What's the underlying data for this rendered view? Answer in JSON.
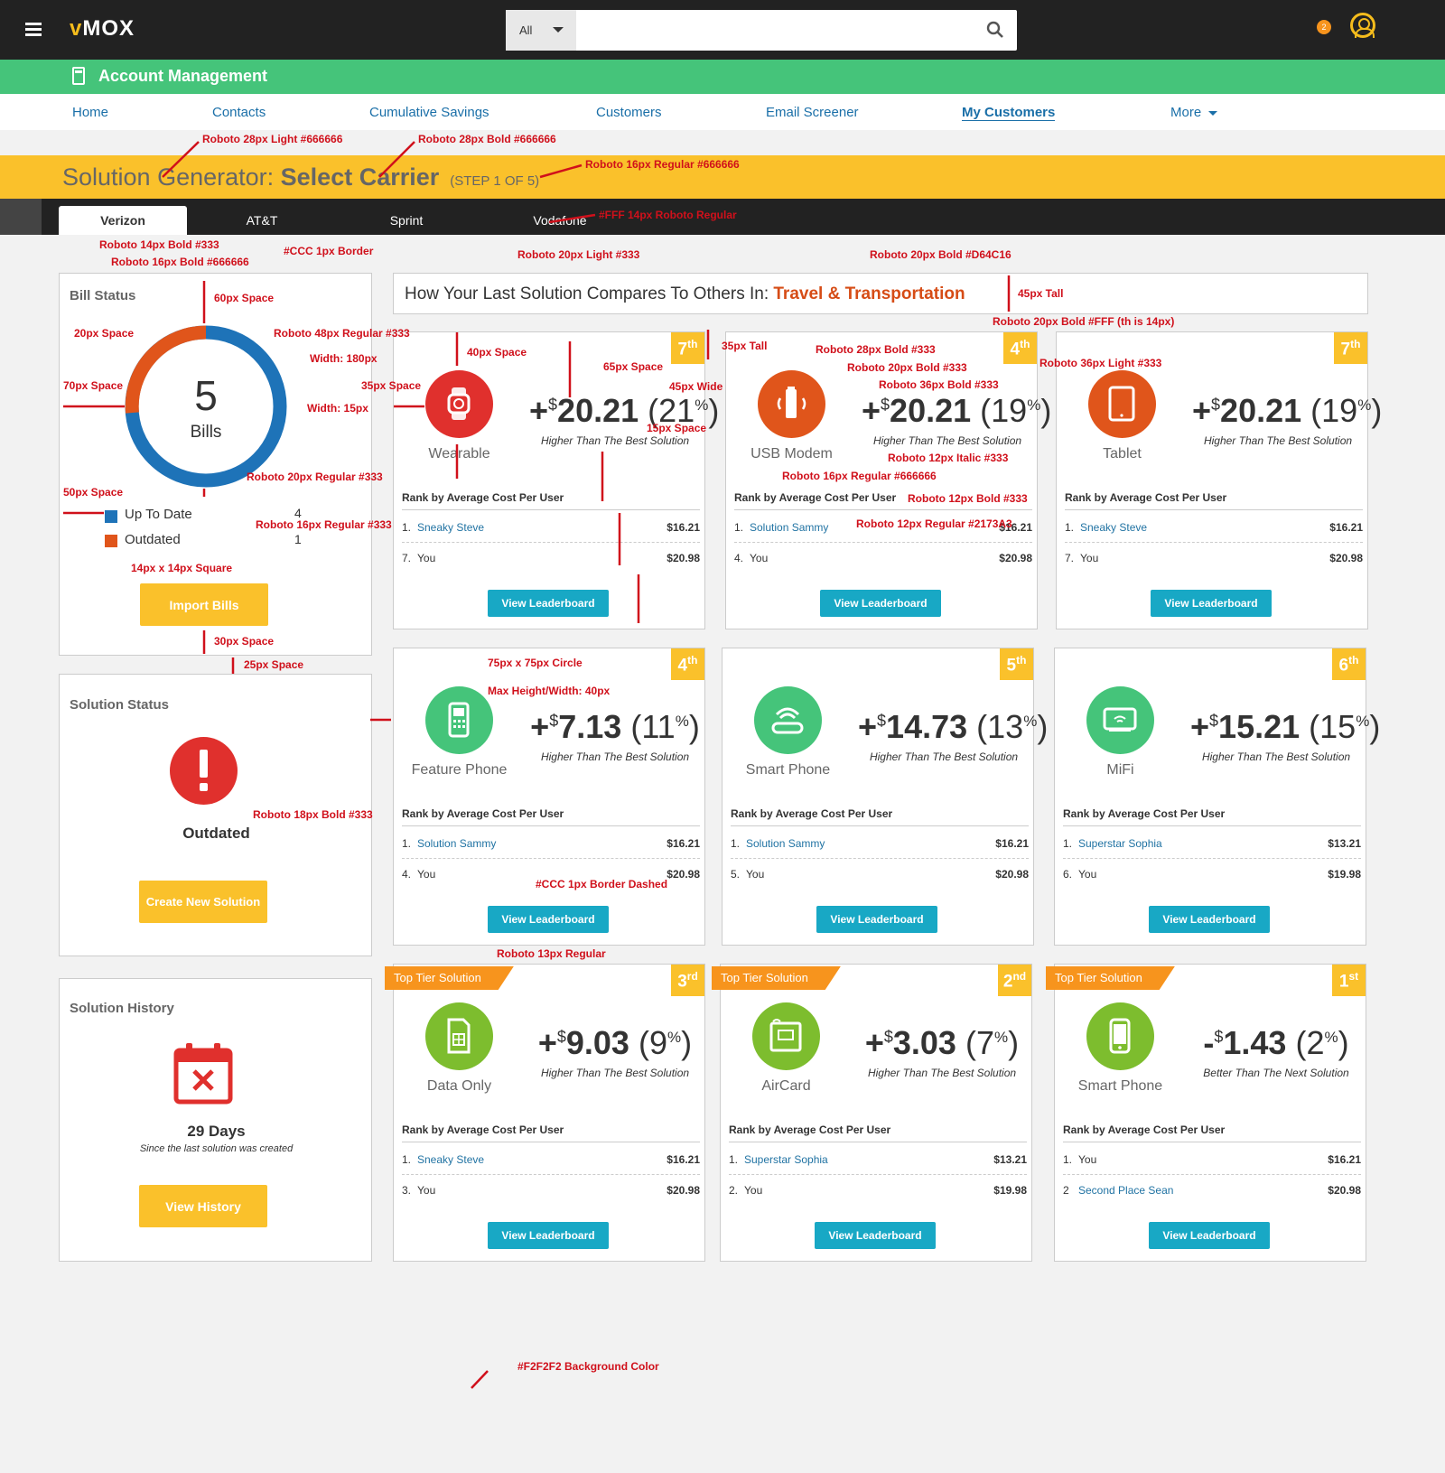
{
  "brand": {
    "logo_v": "v",
    "logo_rest": "MOX"
  },
  "search": {
    "scope": "All",
    "placeholder": ""
  },
  "notifications": {
    "count": "2"
  },
  "module": {
    "title": "Account Management"
  },
  "nav": {
    "items": [
      "Home",
      "Contacts",
      "Cumulative Savings",
      "Customers",
      "Email Screener",
      "My Customers",
      "More"
    ],
    "active": "My Customers"
  },
  "header": {
    "title_light": "Solution Generator: ",
    "title_bold": "Select Carrier",
    "step": "(STEP 1 OF 5)"
  },
  "carriers": {
    "tabs": [
      "Verizon",
      "AT&T",
      "Sprint",
      "Vodafone"
    ],
    "active": "Verizon"
  },
  "bill_status": {
    "title": "Bill Status",
    "total": "5",
    "total_label": "Bills",
    "legend": [
      {
        "label": "Up To Date",
        "count": "4",
        "color": "#1E73B8"
      },
      {
        "label": "Outdated",
        "count": "1",
        "color": "#E0551B"
      }
    ],
    "button": "Import Bills"
  },
  "solution_status": {
    "title": "Solution Status",
    "status": "Outdated",
    "button": "Create New Solution"
  },
  "solution_history": {
    "title": "Solution History",
    "days": "29 Days",
    "caption": "Since the last solution was created",
    "button": "View History"
  },
  "compare": {
    "prefix": "How Your Last Solution Compares To Others In: ",
    "industry": "Travel & Transportation"
  },
  "cards": [
    {
      "rank": "7",
      "rank_suffix": "th",
      "device": "Wearable",
      "icon": "watch-icon",
      "color": "#E0302D",
      "sign": "+",
      "amount": "20.21",
      "pct": "21",
      "sub": "Higher Than The Best Solution",
      "rank_label": "Rank by Average Cost Per User",
      "rows": [
        {
          "n": "1.",
          "name": "Sneaky Steve",
          "amt": "$16.21"
        },
        {
          "n": "7.",
          "name": "You",
          "amt": "$20.98"
        }
      ],
      "button": "View Leaderboard",
      "tier": ""
    },
    {
      "rank": "4",
      "rank_suffix": "th",
      "device": "USB Modem",
      "icon": "usb-modem-icon",
      "color": "#E0551B",
      "sign": "+",
      "amount": "20.21",
      "pct": "19",
      "sub": "Higher Than The Best Solution",
      "rank_label": "Rank by Average Cost Per User",
      "rows": [
        {
          "n": "1.",
          "name": "Solution Sammy",
          "amt": "$16.21"
        },
        {
          "n": "4.",
          "name": "You",
          "amt": "$20.98"
        }
      ],
      "button": "View Leaderboard",
      "tier": ""
    },
    {
      "rank": "7",
      "rank_suffix": "th",
      "device": "Tablet",
      "icon": "tablet-icon",
      "color": "#E0551B",
      "sign": "+",
      "amount": "20.21",
      "pct": "19",
      "sub": "Higher Than The Best Solution",
      "rank_label": "Rank by Average Cost Per User",
      "rows": [
        {
          "n": "1.",
          "name": "Sneaky Steve",
          "amt": "$16.21"
        },
        {
          "n": "7.",
          "name": "You",
          "amt": "$20.98"
        }
      ],
      "button": "View Leaderboard",
      "tier": ""
    },
    {
      "rank": "4",
      "rank_suffix": "th",
      "device": "Feature Phone",
      "icon": "feature-phone-icon",
      "color": "#45C47A",
      "sign": "+",
      "amount": "7.13",
      "pct": "11",
      "sub": "Higher Than The Best Solution",
      "rank_label": "Rank by Average Cost Per User",
      "rows": [
        {
          "n": "1.",
          "name": "Solution Sammy",
          "amt": "$16.21"
        },
        {
          "n": "4.",
          "name": "You",
          "amt": "$20.98"
        }
      ],
      "button": "View Leaderboard",
      "tier": ""
    },
    {
      "rank": "5",
      "rank_suffix": "th",
      "device": "Smart Phone",
      "icon": "wifi-router-icon",
      "color": "#45C47A",
      "sign": "+",
      "amount": "14.73",
      "pct": "13",
      "sub": "Higher Than The Best Solution",
      "rank_label": "Rank by Average Cost Per User",
      "rows": [
        {
          "n": "1.",
          "name": "Solution Sammy",
          "amt": "$16.21"
        },
        {
          "n": "5.",
          "name": "You",
          "amt": "$20.98"
        }
      ],
      "button": "View Leaderboard",
      "tier": ""
    },
    {
      "rank": "6",
      "rank_suffix": "th",
      "device": "MiFi",
      "icon": "mifi-icon",
      "color": "#45C47A",
      "sign": "+",
      "amount": "15.21",
      "pct": "15",
      "sub": "Higher Than The Best Solution",
      "rank_label": "Rank by Average Cost Per User",
      "rows": [
        {
          "n": "1.",
          "name": "Superstar Sophia",
          "amt": "$13.21"
        },
        {
          "n": "6.",
          "name": "You",
          "amt": "$19.98"
        }
      ],
      "button": "View Leaderboard",
      "tier": ""
    },
    {
      "rank": "3",
      "rank_suffix": "rd",
      "device": "Data Only",
      "icon": "sim-card-icon",
      "color": "#7DBD2E",
      "sign": "+",
      "amount": "9.03",
      "pct": "9",
      "sub": "Higher Than The Best Solution",
      "rank_label": "Rank by Average Cost Per User",
      "rows": [
        {
          "n": "1.",
          "name": "Sneaky Steve",
          "amt": "$16.21"
        },
        {
          "n": "3.",
          "name": "You",
          "amt": "$20.98"
        }
      ],
      "button": "View Leaderboard",
      "tier": "Top Tier Solution"
    },
    {
      "rank": "2",
      "rank_suffix": "nd",
      "device": "AirCard",
      "icon": "aircard-icon",
      "color": "#7DBD2E",
      "sign": "+",
      "amount": "3.03",
      "pct": "7",
      "sub": "Higher Than The Best Solution",
      "rank_label": "Rank by Average Cost Per User",
      "rows": [
        {
          "n": "1.",
          "name": "Superstar Sophia",
          "amt": "$13.21"
        },
        {
          "n": "2.",
          "name": "You",
          "amt": "$19.98"
        }
      ],
      "button": "View Leaderboard",
      "tier": "Top Tier Solution"
    },
    {
      "rank": "1",
      "rank_suffix": "st",
      "device": "Smart Phone",
      "icon": "smartphone-icon",
      "color": "#7DBD2E",
      "sign": "-",
      "amount": "1.43",
      "pct": "2",
      "sub": "Better Than The Next Solution",
      "rank_label": "Rank by Average Cost Per User",
      "rows": [
        {
          "n": "1.",
          "name": "You",
          "amt": "$16.21"
        },
        {
          "n": "2",
          "name": "Second Place Sean",
          "amt": "$20.98"
        }
      ],
      "button": "View Leaderboard",
      "tier": "Top Tier Solution"
    }
  ],
  "annotations": [
    "Roboto 28px Light #666666",
    "Roboto 28px Bold #666666",
    "Roboto 16px Regular #666666",
    "#FFF 14px Roboto Regular",
    "Roboto 14px Bold #333",
    "Roboto 16px Bold #666666",
    "#CCC 1px Border",
    "Roboto 20px Light #333",
    "Roboto 20px Bold #D64C16",
    "45px Tall",
    "Roboto 20px Bold #FFF (th is 14px)",
    "60px Space",
    "20px Space",
    "Roboto 48px Regular  #333",
    "Width: 180px",
    "70px Space",
    "35px Space",
    "Width: 15px",
    "Roboto 20px Regular  #333",
    "50px Space",
    "Roboto 16px Regular  #333",
    "14px x 14px Square",
    "30px Space",
    "25px Space",
    "40px Space",
    "65px Space",
    "35px Tall",
    "45px Wide",
    "15px Space",
    "Roboto 28px Bold #333",
    "Roboto 20px Bold #333",
    "Roboto 36px Bold #333",
    "Roboto 36px Light #333",
    "Roboto 12px Italic #333",
    "Roboto 16px Regular #666666",
    "Roboto 12px Bold #333",
    "Roboto 12px Regular #2173A3",
    "75px x 75px Circle",
    "Max Height/Width: 40px",
    "Roboto 18px Bold #333",
    "#CCC 1px Border Dashed",
    "Roboto 13px Regular",
    "#F2F2F2 Background Color"
  ]
}
